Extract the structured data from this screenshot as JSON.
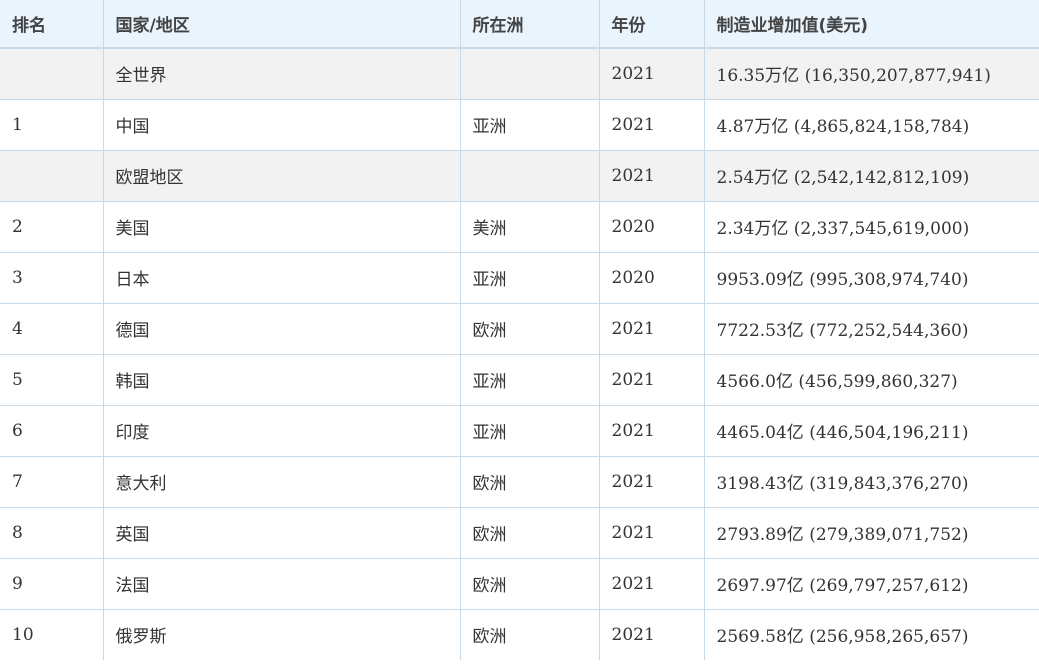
{
  "table": {
    "headers": [
      "排名",
      "国家/地区",
      "所在洲",
      "年份",
      "制造业增加值(美元)"
    ],
    "rows": [
      {
        "rank": "",
        "country": "全世界",
        "continent": "",
        "year": "2021",
        "value": "16.35万亿 (16,350,207,877,941)",
        "aggregate": true
      },
      {
        "rank": "1",
        "country": "中国",
        "continent": "亚洲",
        "year": "2021",
        "value": "4.87万亿 (4,865,824,158,784)",
        "aggregate": false
      },
      {
        "rank": "",
        "country": "欧盟地区",
        "continent": "",
        "year": "2021",
        "value": "2.54万亿 (2,542,142,812,109)",
        "aggregate": true
      },
      {
        "rank": "2",
        "country": "美国",
        "continent": "美洲",
        "year": "2020",
        "value": "2.34万亿 (2,337,545,619,000)",
        "aggregate": false
      },
      {
        "rank": "3",
        "country": "日本",
        "continent": "亚洲",
        "year": "2020",
        "value": "9953.09亿 (995,308,974,740)",
        "aggregate": false
      },
      {
        "rank": "4",
        "country": "德国",
        "continent": "欧洲",
        "year": "2021",
        "value": "7722.53亿 (772,252,544,360)",
        "aggregate": false
      },
      {
        "rank": "5",
        "country": "韩国",
        "continent": "亚洲",
        "year": "2021",
        "value": "4566.0亿 (456,599,860,327)",
        "aggregate": false
      },
      {
        "rank": "6",
        "country": "印度",
        "continent": "亚洲",
        "year": "2021",
        "value": "4465.04亿 (446,504,196,211)",
        "aggregate": false
      },
      {
        "rank": "7",
        "country": "意大利",
        "continent": "欧洲",
        "year": "2021",
        "value": "3198.43亿 (319,843,376,270)",
        "aggregate": false
      },
      {
        "rank": "8",
        "country": "英国",
        "continent": "欧洲",
        "year": "2021",
        "value": "2793.89亿 (279,389,071,752)",
        "aggregate": false
      },
      {
        "rank": "9",
        "country": "法国",
        "continent": "欧洲",
        "year": "2021",
        "value": "2697.97亿 (269,797,257,612)",
        "aggregate": false
      },
      {
        "rank": "10",
        "country": "俄罗斯",
        "continent": "欧洲",
        "year": "2021",
        "value": "2569.58亿 (256,958,265,657)",
        "aggregate": false
      }
    ]
  }
}
